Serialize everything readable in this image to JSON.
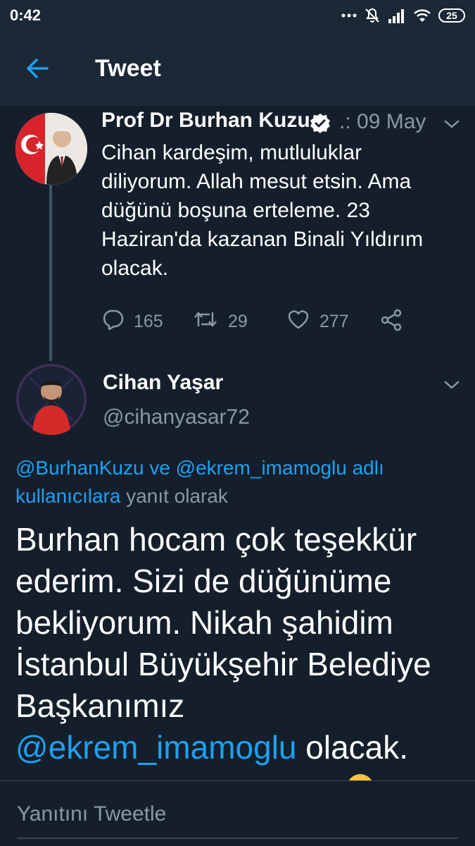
{
  "status_bar": {
    "time": "0:42",
    "icons": [
      "dots-icon",
      "mute-icon",
      "signal-icon",
      "wifi-icon",
      "battery-icon"
    ],
    "battery": "25"
  },
  "header": {
    "back_icon": "arrow-left-icon",
    "title": "Tweet"
  },
  "parent_tweet": {
    "author_name": "Prof Dr Burhan Kuzu",
    "verified_icon": "verified-badge-icon",
    "date": ".: 09 May",
    "text": "Cihan kardeşim, mutluluklar diliyorum. Allah mesut etsin. Ama düğünü boşuna erteleme. 23 Haziran'da kazanan Binali Yıldırım olacak.",
    "reply_count": "165",
    "retweet_count": "29",
    "like_count": "277"
  },
  "main_tweet": {
    "author_name": "Cihan Yaşar",
    "handle": "@cihanyasar72",
    "reply_to_users": "@BurhanKuzu ve @ekrem_imamoglu adlı kullanıcılara",
    "reply_to_suffix": "yanıt olarak",
    "text_before_mention": "Burhan hocam çok teşekkür ederim. Sizi de düğünüme bekliyorum. Nikah şahidim İstanbul Büyükşehir Belediye Başkanımız",
    "mention": "@ekrem_imamoglu",
    "text_after_mention": "olacak."
  },
  "composer": {
    "placeholder": "Yanıtını Tweetle"
  },
  "colors": {
    "background": "#151f2b",
    "header": "#1b2836",
    "accent": "#1da1f2",
    "secondary_text": "#8899a6"
  }
}
